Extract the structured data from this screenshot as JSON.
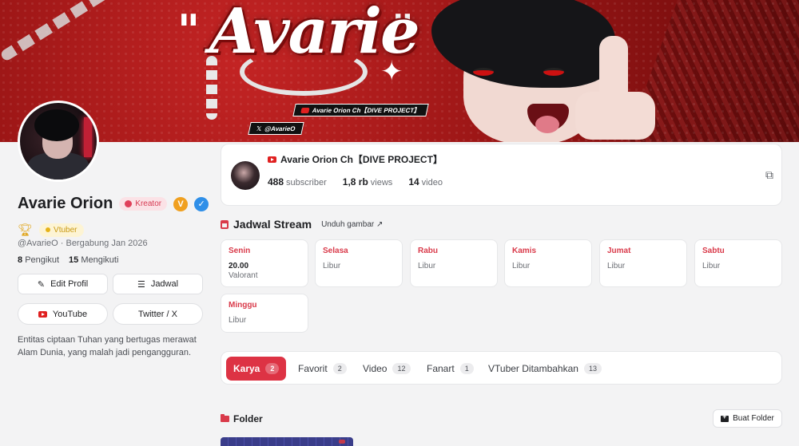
{
  "banner": {
    "logo_text": "Avarie",
    "youtube_tag": "Avarie Orion Ch【DIVE PROJECT】",
    "x_tag": "@AvarieO"
  },
  "profile": {
    "name": "Avarie Orion",
    "creator_badge": "Kreator",
    "v_badge": "V",
    "verified_icon": "check-badge-icon",
    "role_badge": "Vtuber",
    "handle_joined": "@AvarieO · Bergabung Jan 2026",
    "followers_count": "8",
    "followers_label": "Pengikut",
    "following_count": "15",
    "following_label": "Mengikuti",
    "bio": "Entitas ciptaan Tuhan yang bertugas merawat Alam Dunia, yang malah jadi pengangguran."
  },
  "buttons": {
    "edit_profile": "Edit Profil",
    "schedule": "Jadwal",
    "youtube": "YouTube",
    "twitter": "Twitter / X"
  },
  "channel": {
    "title": "Avarie Orion Ch【DIVE PROJECT】",
    "subscribers": "488",
    "subscribers_label": "subscriber",
    "views": "1,8 rb",
    "views_label": "views",
    "videos": "14",
    "videos_label": "video",
    "external_icon": "external-link-icon"
  },
  "schedule": {
    "title": "Jadwal Stream",
    "download": "Unduh gambar ↗",
    "days": [
      {
        "name": "Senin",
        "time": "20.00",
        "desc": "Valorant"
      },
      {
        "name": "Selasa",
        "desc": "Libur"
      },
      {
        "name": "Rabu",
        "desc": "Libur"
      },
      {
        "name": "Kamis",
        "desc": "Libur"
      },
      {
        "name": "Jumat",
        "desc": "Libur"
      },
      {
        "name": "Sabtu",
        "desc": "Libur"
      },
      {
        "name": "Minggu",
        "desc": "Libur"
      }
    ]
  },
  "tabs": [
    {
      "label": "Karya",
      "count": "2"
    },
    {
      "label": "Favorit",
      "count": "2"
    },
    {
      "label": "Video",
      "count": "12"
    },
    {
      "label": "Fanart",
      "count": "1"
    },
    {
      "label": "VTuber Ditambahkan",
      "count": "13"
    }
  ],
  "folder": {
    "title": "Folder",
    "new_folder": "Buat Folder"
  },
  "colors": {
    "accent": "#dd3344",
    "banner": "#b01c1c",
    "verified": "#2f8fe8",
    "v_badge": "#f0a020"
  }
}
